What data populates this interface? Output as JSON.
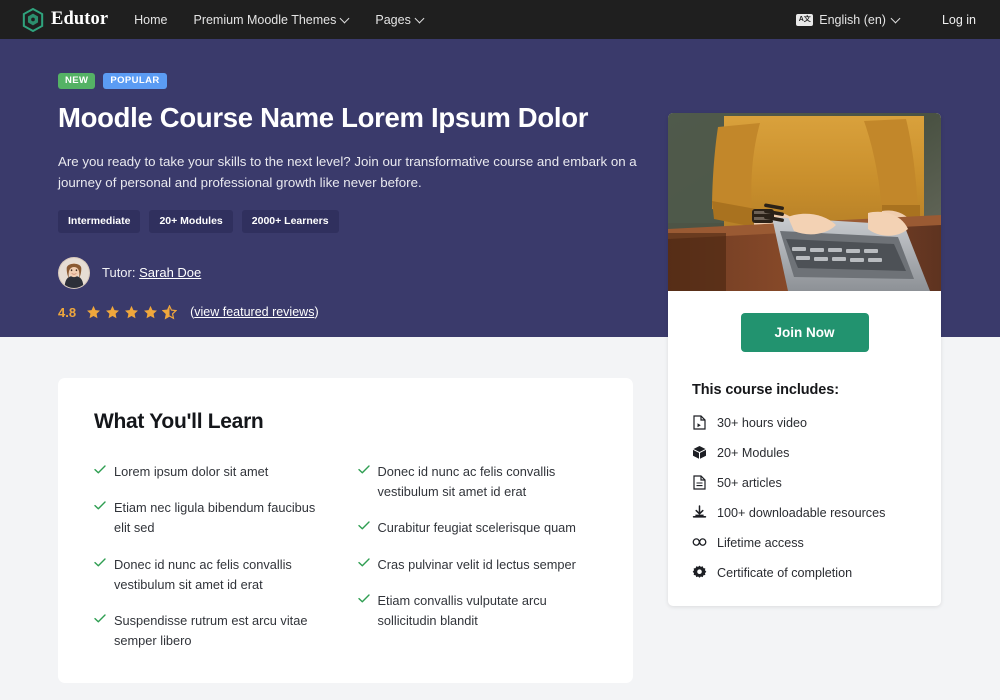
{
  "navbar": {
    "brand": "Edutor",
    "brand_icon": "hexagon-logo-icon",
    "links": [
      {
        "label": "Home",
        "has_caret": false
      },
      {
        "label": "Premium Moodle Themes",
        "has_caret": true
      },
      {
        "label": "Pages",
        "has_caret": true
      }
    ],
    "language": {
      "label": "English (en)",
      "icon": "translate-icon",
      "has_caret": true
    },
    "login_label": "Log in",
    "background": "#1f1f1f"
  },
  "hero": {
    "background": "#3a3a6b",
    "badges": [
      {
        "label": "NEW",
        "color": "#54b265"
      },
      {
        "label": "POPULAR",
        "color": "#5b9cf4"
      }
    ],
    "title": "Moodle Course Name Lorem Ipsum Dolor",
    "description": "Are you ready to take your skills to the next level? Join our transformative course and embark on a journey of personal and professional growth like never before.",
    "chips": [
      "Intermediate",
      "20+ Modules",
      "2000+ Learners"
    ],
    "tutor": {
      "prefix": "Tutor:",
      "name": "Sarah Doe",
      "avatar": "tutor-avatar"
    },
    "rating": {
      "value": "4.8",
      "stars_filled": 4,
      "stars_half": 1,
      "stars_total": 5,
      "star_color": "#f0a73c",
      "reviews_link": "view featured reviews",
      "reviews_open": "(",
      "reviews_close": ")"
    }
  },
  "side_card": {
    "photo_alt": "person-typing-on-laptop-photo",
    "join_label": "Join Now",
    "join_color": "#22936f",
    "includes_title": "This course includes:",
    "includes": [
      {
        "icon": "file-video-icon",
        "label": "30+ hours video"
      },
      {
        "icon": "cube-icon",
        "label": "20+ Modules"
      },
      {
        "icon": "document-icon",
        "label": "50+ articles"
      },
      {
        "icon": "download-icon",
        "label": "100+ downloadable resources"
      },
      {
        "icon": "infinity-icon",
        "label": "Lifetime access"
      },
      {
        "icon": "certificate-icon",
        "label": "Certificate of completion"
      }
    ]
  },
  "main_card": {
    "title": "What You'll Learn",
    "check_color": "#2f9e52",
    "left_items": [
      "Lorem ipsum dolor sit amet",
      "Etiam nec ligula bibendum faucibus elit sed",
      "Donec id nunc ac felis convallis vestibulum sit amet id erat",
      "Suspendisse rutrum est arcu vitae semper libero"
    ],
    "right_items": [
      "Donec id nunc ac felis convallis vestibulum sit amet id erat",
      "Curabitur feugiat scelerisque quam",
      "Cras pulvinar velit id lectus semper",
      "Etiam convallis vulputate arcu sollicitudin blandit"
    ]
  }
}
